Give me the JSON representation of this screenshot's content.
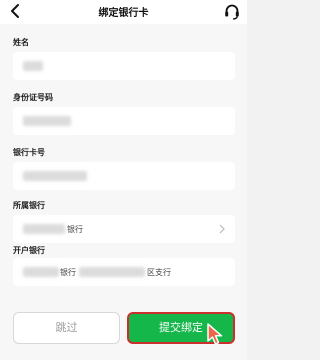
{
  "header": {
    "title": "绑定银行卡"
  },
  "form": {
    "name_label": "姓名",
    "id_label": "身份证号码",
    "card_label": "银行卡号",
    "bank_label": "所属银行",
    "bank_value_suffix": "银行",
    "branch_label": "开户银行",
    "branch_mid": "银行",
    "branch_suffix": "区支行"
  },
  "buttons": {
    "skip": "跳过",
    "submit": "提交绑定"
  },
  "colors": {
    "accent": "#15b64a",
    "highlight_border": "#c9302c",
    "cursor": "#e8684a"
  },
  "icons": {
    "back": "back-arrow-icon",
    "support": "headset-icon",
    "chevron": "chevron-right-icon",
    "cursor": "mouse-cursor-icon"
  }
}
